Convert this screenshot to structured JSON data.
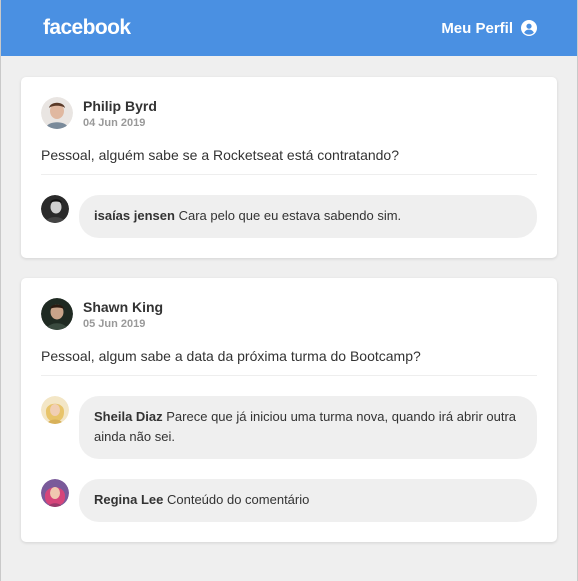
{
  "header": {
    "logo": "facebook",
    "profile_label": "Meu Perfil",
    "profile_icon": "user-circle-icon",
    "color": "#4a90e2"
  },
  "posts": [
    {
      "author": "Philip Byrd",
      "date": "04 Jun 2019",
      "content": "Pessoal, alguém sabe se a Rocketseat está contratando?",
      "comments": [
        {
          "author": "isaías jensen",
          "content": "Cara pelo que eu estava sabendo sim."
        }
      ]
    },
    {
      "author": "Shawn King",
      "date": "05 Jun 2019",
      "content": "Pessoal, algum sabe a data da próxima turma do Bootcamp?",
      "comments": [
        {
          "author": "Sheila Diaz",
          "content": "Parece que já iniciou uma turma nova, quando irá abrir outra ainda não sei."
        },
        {
          "author": "Regina Lee",
          "content": "Conteúdo do comentário"
        }
      ]
    }
  ]
}
